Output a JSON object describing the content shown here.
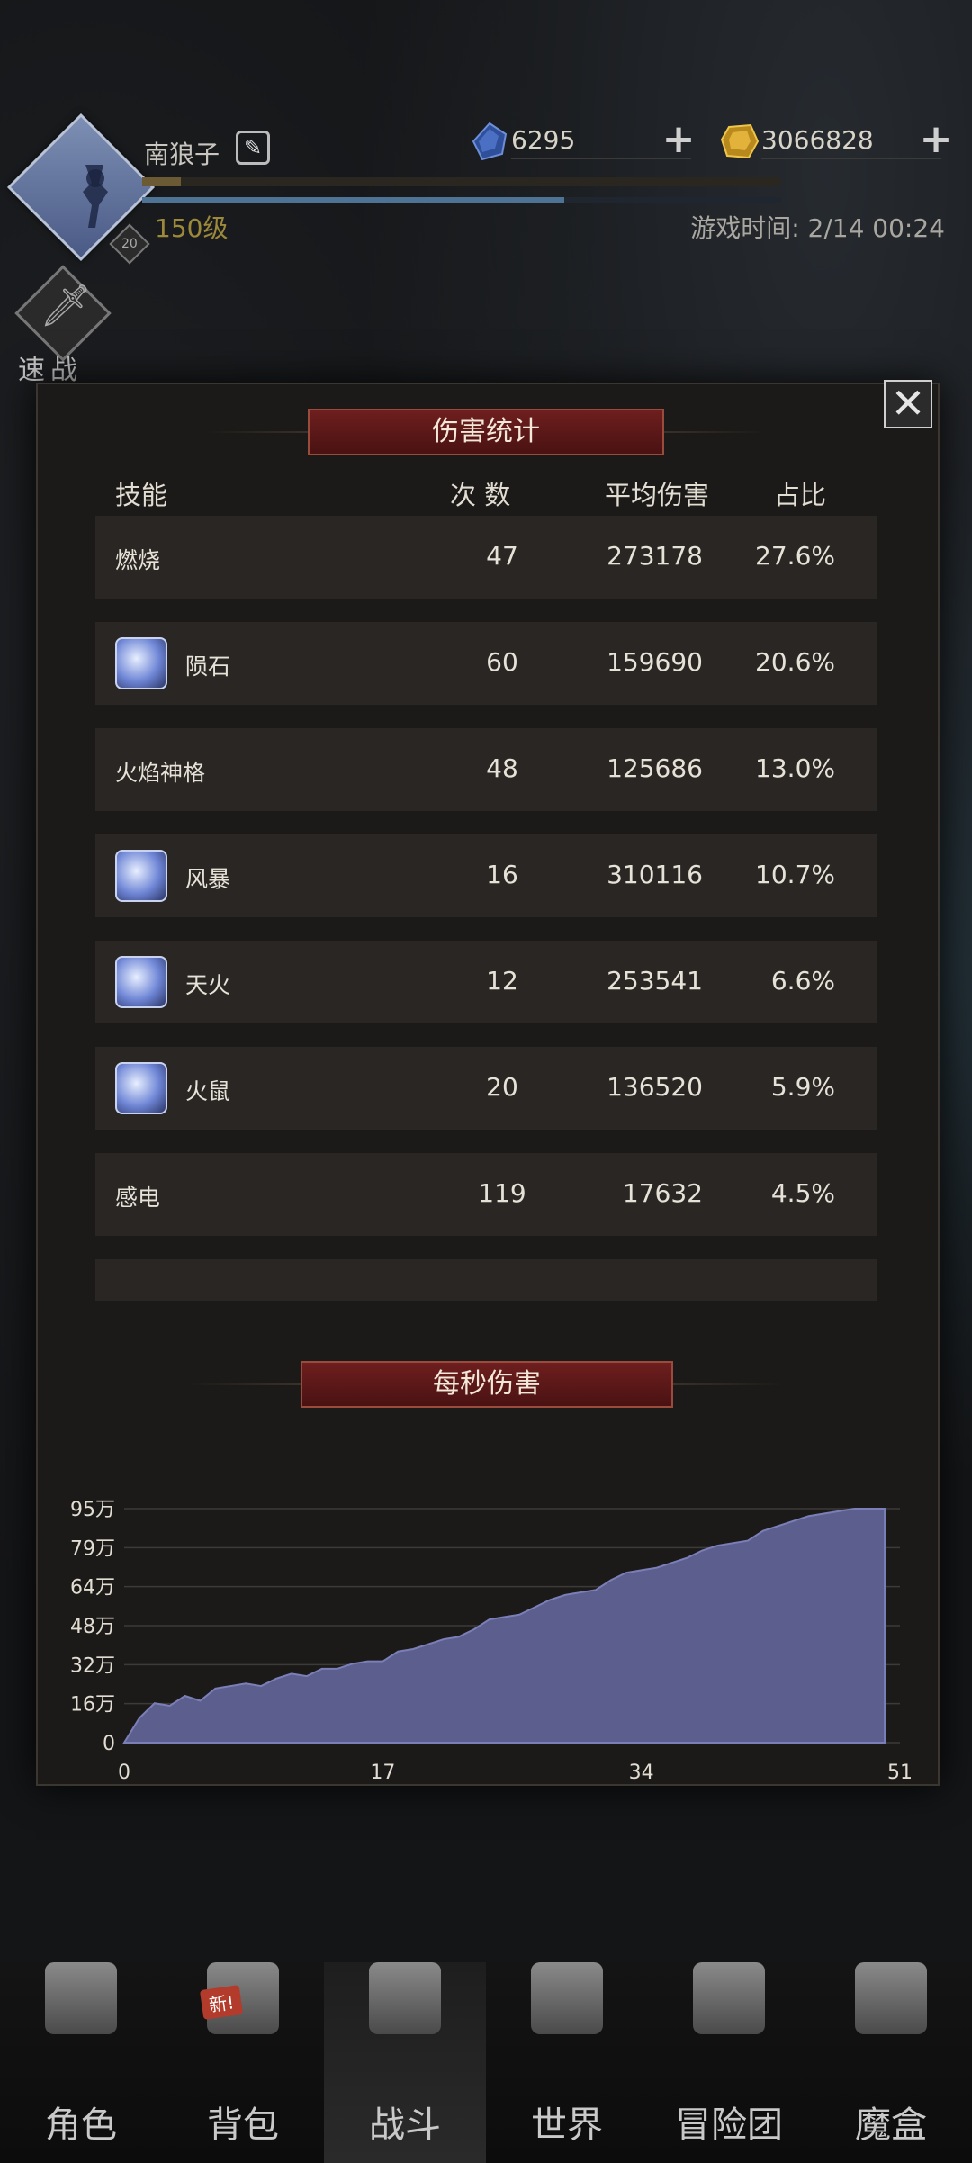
{
  "header": {
    "player_name": "南狼子",
    "level": "150级",
    "level_chip": "20",
    "game_time": "游戏时间: 2/14 00:24",
    "xp_fraction": 0.06,
    "mp_fraction": 0.66
  },
  "resources": {
    "gems": "6295",
    "gold": "3066828"
  },
  "quick_battle": {
    "label": "速战"
  },
  "damage_stats": {
    "title": "伤害统计",
    "headers": {
      "skill": "技能",
      "count": "次 数",
      "avg": "平均伤害",
      "pct": "占比"
    },
    "rows": [
      {
        "name": "燃烧",
        "count": "47",
        "avg": "273178",
        "pct": "27.6%",
        "has_icon": false
      },
      {
        "name": "陨石",
        "count": "60",
        "avg": "159690",
        "pct": "20.6%",
        "has_icon": true
      },
      {
        "name": "火焰神格",
        "count": "48",
        "avg": "125686",
        "pct": "13.0%",
        "has_icon": false
      },
      {
        "name": "风暴",
        "count": "16",
        "avg": "310116",
        "pct": "10.7%",
        "has_icon": true
      },
      {
        "name": "天火",
        "count": "12",
        "avg": "253541",
        "pct": "6.6%",
        "has_icon": true
      },
      {
        "name": "火鼠",
        "count": "20",
        "avg": "136520",
        "pct": "5.9%",
        "has_icon": true
      },
      {
        "name": "感电",
        "count": "119",
        "avg": "17632",
        "pct": "4.5%",
        "has_icon": false
      }
    ]
  },
  "dps": {
    "title": "每秒伤害"
  },
  "chart_data": {
    "type": "area",
    "title": "每秒伤害",
    "x_ticks": [
      "0",
      "17",
      "34",
      "51"
    ],
    "y_ticks": [
      "0",
      "16万",
      "32万",
      "48万",
      "64万",
      "79万",
      "95万"
    ],
    "xlim": [
      0,
      51
    ],
    "ylim": [
      0,
      95
    ],
    "y_unit": "万",
    "grid": true,
    "color": "#5c5f8e",
    "x": [
      0,
      1,
      2,
      3,
      4,
      5,
      6,
      7,
      8,
      9,
      10,
      11,
      12,
      13,
      14,
      15,
      16,
      17,
      18,
      19,
      20,
      21,
      22,
      23,
      24,
      25,
      26,
      27,
      28,
      29,
      30,
      31,
      32,
      33,
      34,
      35,
      36,
      37,
      38,
      39,
      40,
      41,
      42,
      43,
      44,
      45,
      46,
      47,
      48,
      49,
      50
    ],
    "values": [
      0,
      10,
      16,
      15,
      19,
      17,
      22,
      23,
      24,
      23,
      26,
      28,
      27,
      30,
      30,
      32,
      33,
      33,
      37,
      38,
      40,
      42,
      43,
      46,
      50,
      51,
      52,
      55,
      58,
      60,
      61,
      62,
      66,
      69,
      70,
      71,
      73,
      75,
      78,
      80,
      81,
      82,
      86,
      88,
      90,
      92,
      93,
      94,
      95,
      95,
      95
    ]
  },
  "close_label": "✕",
  "nav": [
    {
      "label": "角色",
      "icon": "helmet-icon"
    },
    {
      "label": "背包",
      "icon": "backpack-icon",
      "badge": "新!"
    },
    {
      "label": "战斗",
      "icon": "shield-sword-icon"
    },
    {
      "label": "世界",
      "icon": "map-scroll-icon"
    },
    {
      "label": "冒险团",
      "icon": "castle-icon"
    },
    {
      "label": "魔盒",
      "icon": "cube-icon"
    }
  ]
}
